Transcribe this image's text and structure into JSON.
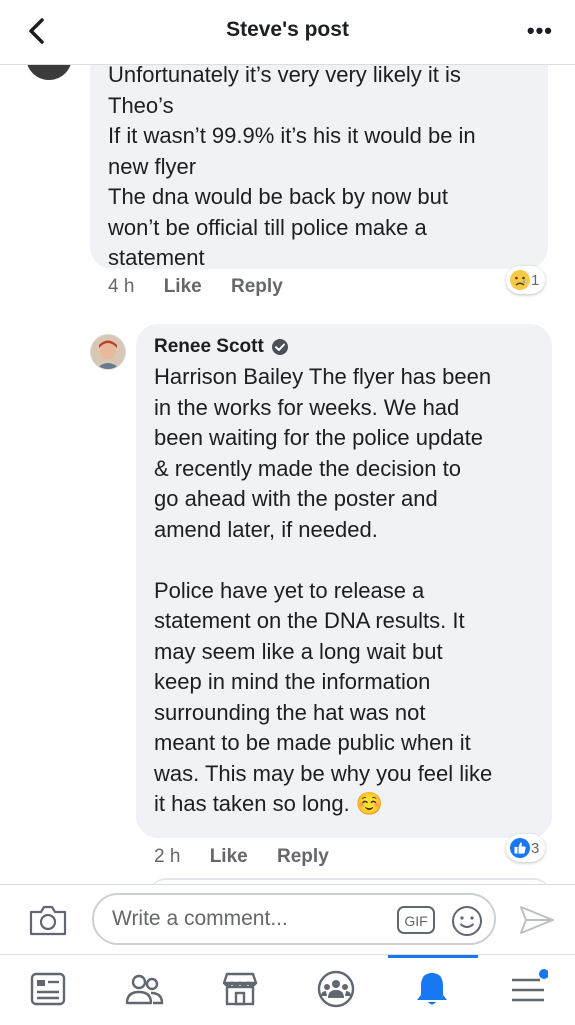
{
  "header": {
    "title": "Steve's post",
    "more": "•••"
  },
  "comment1": {
    "text": "Unfortunately it’s very very likely it is\nTheo’s\nIf it wasn’t 99.9% it’s his it would be in\nnew flyer\nThe dna would be back by now but\nwon’t be official till police make a\nstatement",
    "time": "4 h",
    "like": "Like",
    "reply": "Reply",
    "reaction_count": "1",
    "reaction_icon": "sad-cry-emoji"
  },
  "comment2": {
    "author": "Renee Scott",
    "text": "Harrison Bailey The flyer has been\nin the works for weeks. We had\nbeen waiting for the police update\n& recently made the decision to\ngo ahead with the poster and\namend later, if needed.\n\nPolice have yet to release a\nstatement on the DNA results. It\nmay seem like a long wait but\nkeep in mind the information\nsurrounding the hat was not\nmeant to be made public when it\nwas. This may be why you feel like\nit has taken so long. ☺️",
    "time": "2 h",
    "like": "Like",
    "reply": "Reply",
    "reaction_count": "3",
    "reaction_icon": "thumbs-up"
  },
  "composer": {
    "placeholder": "Write a comment...",
    "gif": "GIF"
  },
  "tabs": [
    "news-feed",
    "friends",
    "marketplace",
    "groups",
    "notifications",
    "menu"
  ],
  "colors": {
    "accent": "#1877f2",
    "bubble": "#f0f2f5",
    "meta": "#65676b"
  }
}
